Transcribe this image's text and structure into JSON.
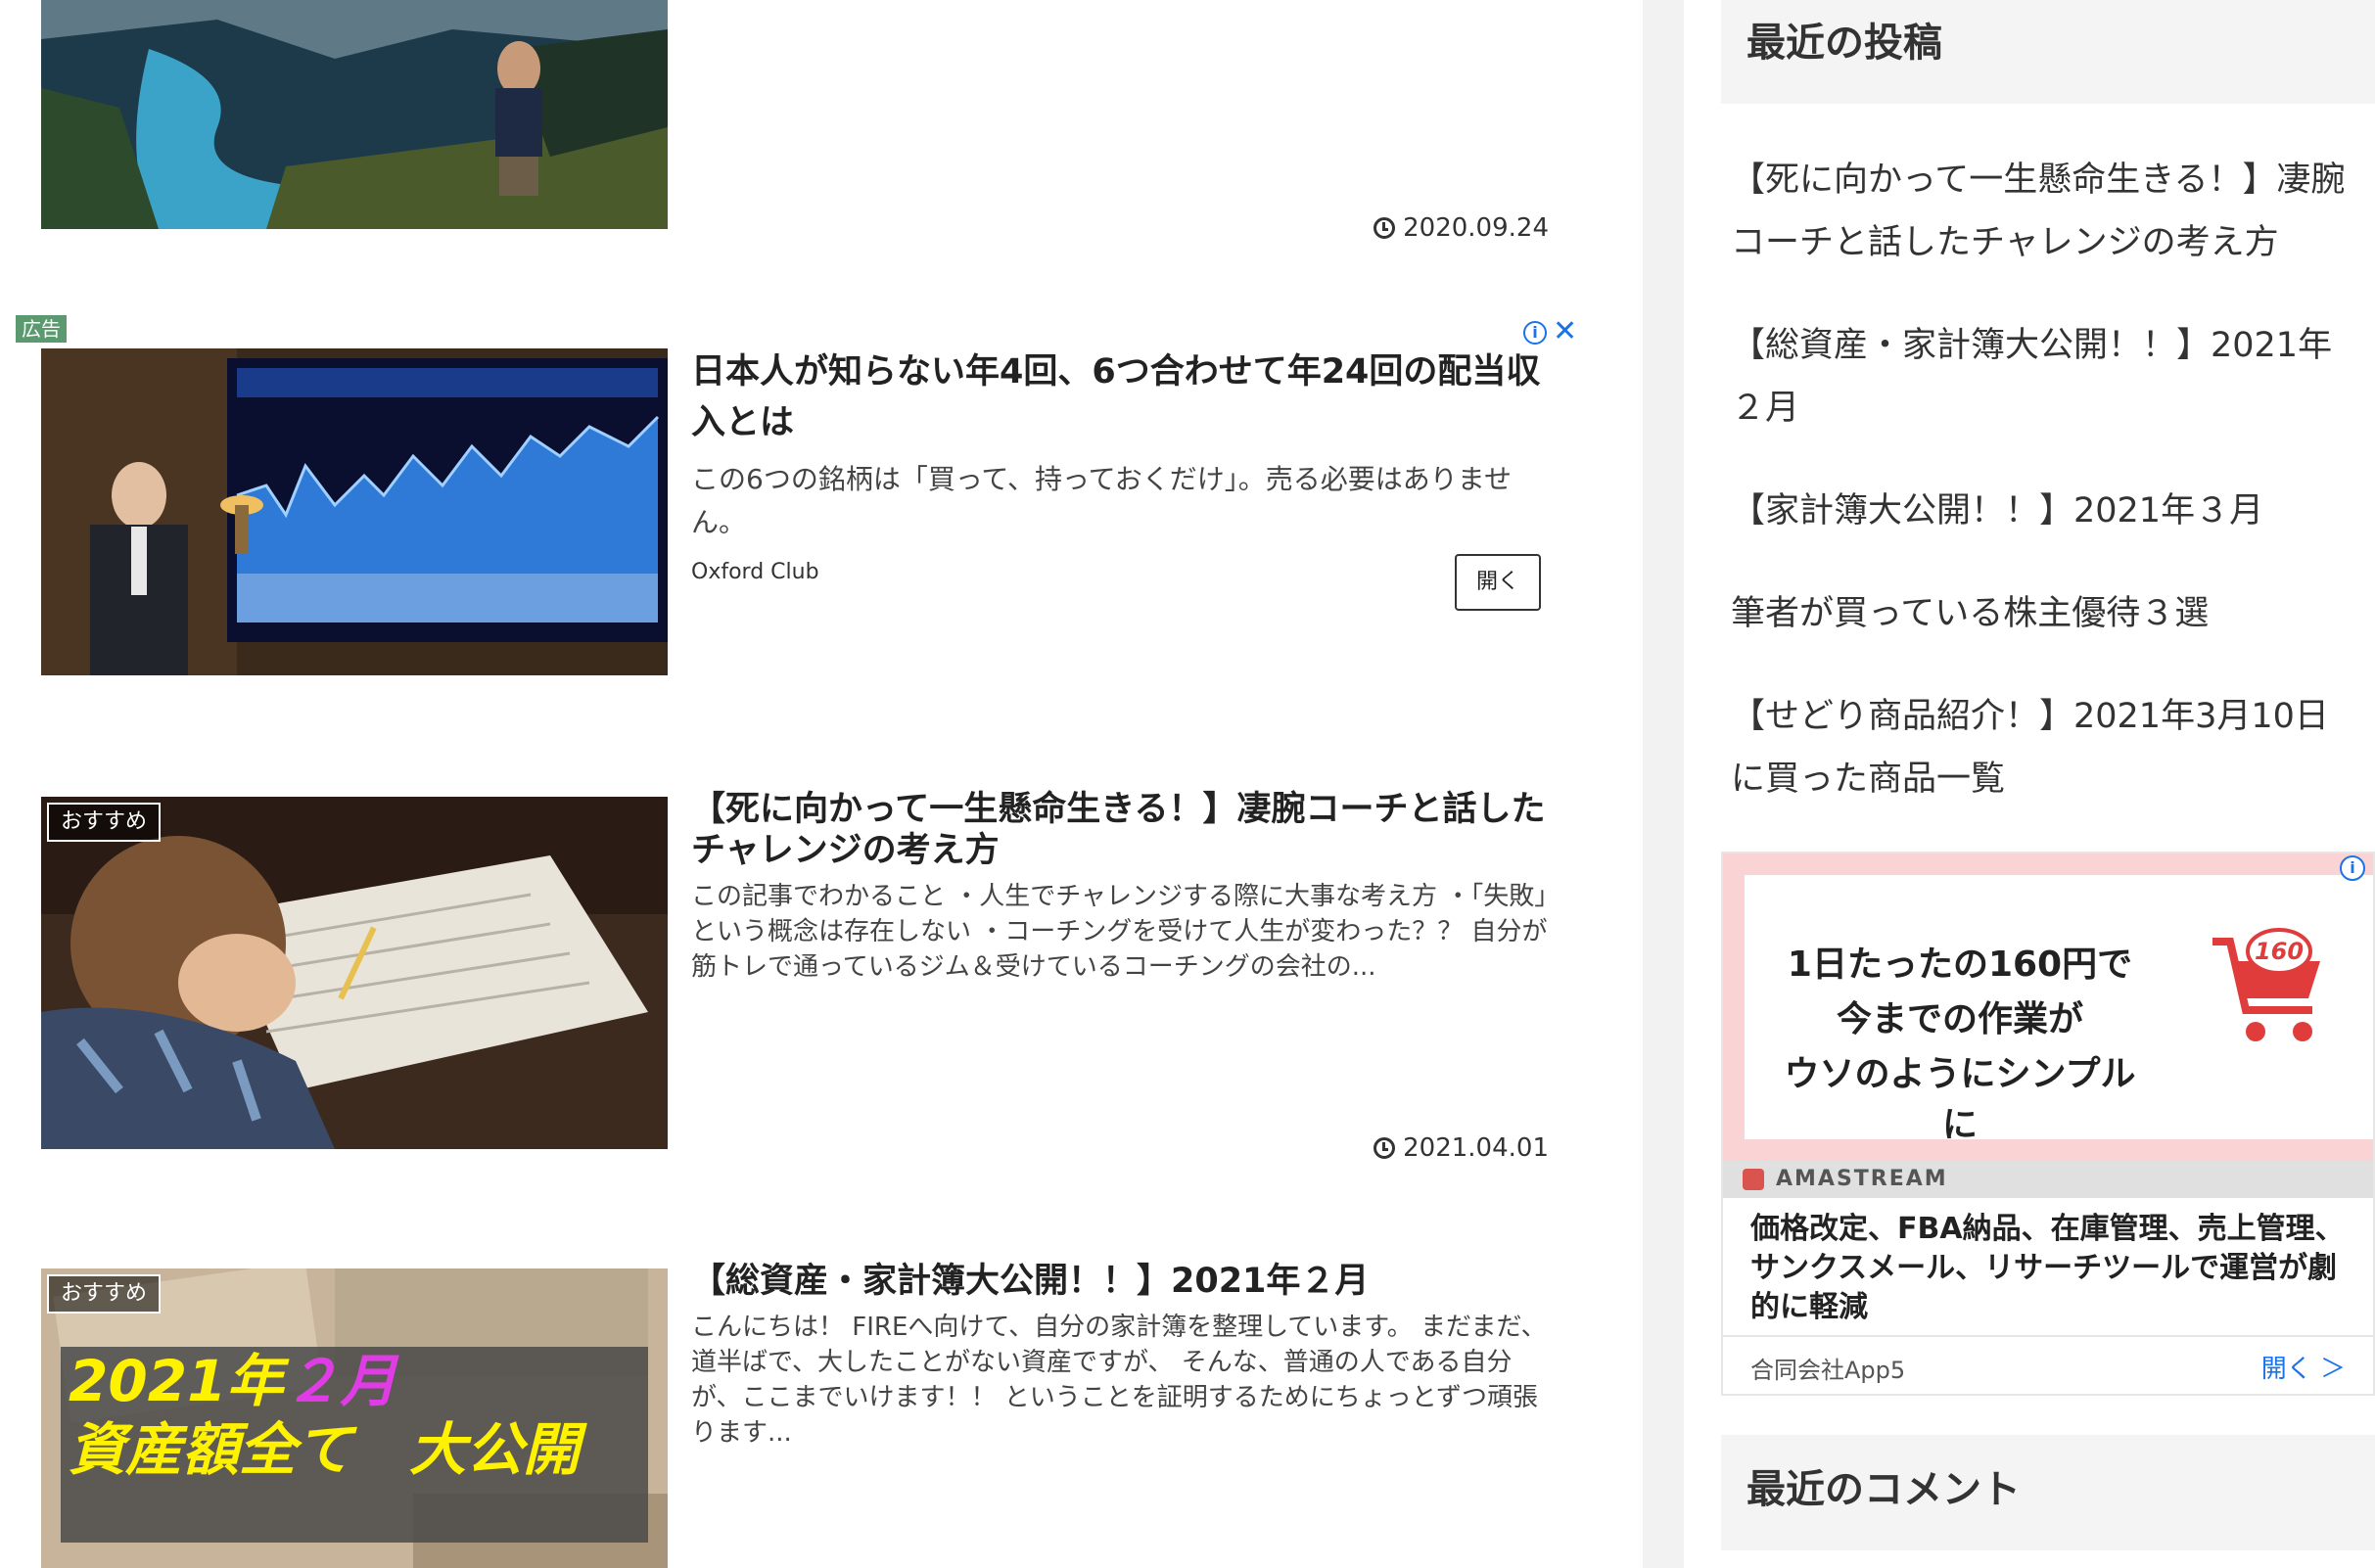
{
  "posts": [
    {
      "date": "2020.09.24"
    },
    {
      "badge": "おすすめ",
      "title": "【死に向かって一生懸命生きる！】凄腕コーチと話したチャレンジの考え方",
      "excerpt": "この記事でわかること ・人生でチャレンジする際に大事な考え方 ・「失敗」という概念は存在しない ・コーチングを受けて人生が変わった？？ 自分が筋トレで通っているジム＆受けているコーチングの会社の...",
      "date": "2021.04.01"
    },
    {
      "badge": "おすすめ",
      "title": "【総資産・家計簿大公開！！】2021年２月",
      "excerpt": "こんにちは！ FIREへ向けて、自分の家計簿を整理しています。 まだまだ、道半ばで、大したことがない資産ですが、 そんな、普通の人である自分が、ここまでいけます！！ ということを証明するためにちょっとずつ頑張ります...",
      "thumb_line1a": "2021年",
      "thumb_line1b": "２月",
      "thumb_line2": "資産額全て　大公開"
    }
  ],
  "ad_main": {
    "label": "広告",
    "title": "日本人が知らない年4回、6つ合わせて年24回の配当収入とは",
    "description": "この6つの銘柄は「買って、持っておくだけ」。売る必要はありません。",
    "advertiser": "Oxford Club",
    "open_label": "開く",
    "info_icon": "i"
  },
  "sidebar": {
    "recent_posts_heading": "最近の投稿",
    "recent_posts": [
      "【死に向かって一生懸命生きる！】凄腕コーチと話したチャレンジの考え方",
      "【総資産・家計簿大公開！！】2021年２月",
      "【家計簿大公開！！】2021年３月",
      "筆者が買っている株主優待３選",
      "【せどり商品紹介！】2021年3月10日に買った商品一覧"
    ],
    "ad": {
      "line1": "1日たったの160円で",
      "line2": "今までの作業が",
      "line3": "ウソのようにシンプルに",
      "cart_price": "160",
      "brand": "AMASTREAM",
      "description": "価格改定、FBA納品、在庫管理、売上管理、サンクスメール、リサーチツールで運営が劇的に軽減",
      "advertiser": "合同会社App5",
      "open_label": "開く ＞"
    },
    "recent_comments_heading": "最近のコメント"
  },
  "colors": {
    "accent_blue": "#1a73e8",
    "ad_label_green": "#5a9a6e",
    "ad_pink": "#fad4d4"
  }
}
